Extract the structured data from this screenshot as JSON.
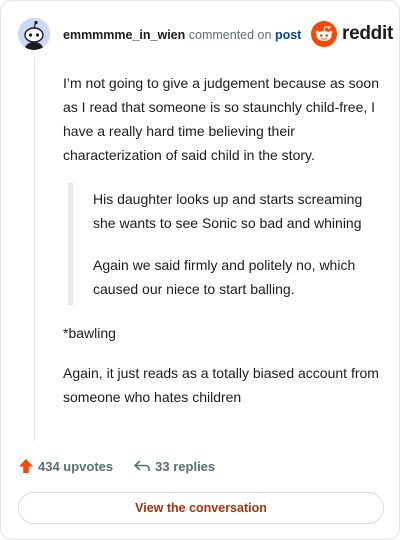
{
  "comment": {
    "username": "emmmmme_in_wien",
    "action_text": "commented on",
    "post_link": "post",
    "brand": "reddit",
    "paragraphs": [
      "I’m not going to give a judgement because as soon as I read that someone is so staunchly child-free, I have a really hard time believing their characterization of said child in the story."
    ],
    "quote": [
      "His daughter looks up and starts screaming she wants to see Sonic so bad and whining",
      "Again we said firmly and politely no, which caused our niece to start balling."
    ],
    "after_quote": [
      "*bawling",
      "Again, it just reads as a totally biased account from someone who hates children"
    ]
  },
  "actions": {
    "upvotes": "434 upvotes",
    "replies": "33 replies"
  },
  "cta": {
    "label": "View the conversation"
  },
  "colors": {
    "upvote": "#ff4500",
    "link": "#0045ac",
    "cta_text": "#b3300c",
    "avatar_bg": "#c9d8fb"
  },
  "icons": [
    "snoo-avatar-icon",
    "reddit-logo-icon",
    "upvote-arrow-icon",
    "reply-arrow-icon"
  ]
}
